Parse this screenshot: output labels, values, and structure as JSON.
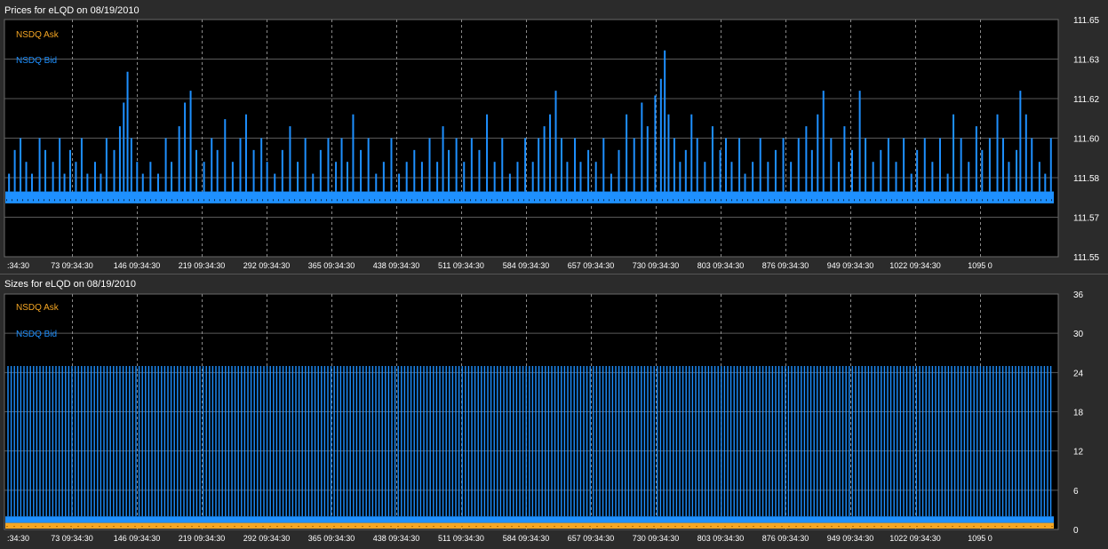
{
  "colors": {
    "panel_bg": "#2b2b2b",
    "plot_bg": "#000000",
    "grid": "#8a8a8a",
    "ask": "#f5a623",
    "bid": "#1e90ff",
    "text": "#ffffff"
  },
  "chart_data": [
    {
      "type": "line",
      "title": "Prices for  eLQD  on  08/19/2010",
      "legend": [
        {
          "name": "NSDQ Ask",
          "color": "#f5a623"
        },
        {
          "name": "NSDQ Bid",
          "color": "#1e90ff"
        }
      ],
      "legend_position": "top-left",
      "ylim": [
        111.55,
        111.65
      ],
      "y_ticks": [
        "111.65",
        "111.63",
        "111.62",
        "111.60",
        "111.58",
        "111.57",
        "111.55"
      ],
      "x_ticks": [
        ":34:30",
        "73 09:34:30",
        "146 09:34:30",
        "219 09:34:30",
        "292 09:34:30",
        "365 09:34:30",
        "438 09:34:30",
        "511 09:34:30",
        "584 09:34:30",
        "657 09:34:30",
        "730 09:34:30",
        "803 09:34:30",
        "876 09:34:30",
        "949 09:34:30",
        "1022 09:34:30",
        "1095 0"
      ],
      "x_range": [
        0,
        1095
      ],
      "grid": true,
      "series": [
        {
          "name": "NSDQ Bid",
          "base_band": [
            111.5725,
            111.5775
          ],
          "spikes": [
            [
              2,
              111.585
            ],
            [
              8,
              111.595
            ],
            [
              14,
              111.6
            ],
            [
              20,
              111.59
            ],
            [
              26,
              111.585
            ],
            [
              34,
              111.6
            ],
            [
              40,
              111.595
            ],
            [
              48,
              111.59
            ],
            [
              55,
              111.6
            ],
            [
              60,
              111.585
            ],
            [
              66,
              111.595
            ],
            [
              72,
              111.59
            ],
            [
              78,
              111.6
            ],
            [
              84,
              111.585
            ],
            [
              92,
              111.59
            ],
            [
              98,
              111.585
            ],
            [
              104,
              111.6
            ],
            [
              112,
              111.595
            ],
            [
              118,
              111.605
            ],
            [
              122,
              111.615
            ],
            [
              126,
              111.628
            ],
            [
              130,
              111.6
            ],
            [
              136,
              111.59
            ],
            [
              142,
              111.585
            ],
            [
              150,
              111.59
            ],
            [
              158,
              111.585
            ],
            [
              166,
              111.6
            ],
            [
              172,
              111.59
            ],
            [
              180,
              111.605
            ],
            [
              186,
              111.615
            ],
            [
              192,
              111.62
            ],
            [
              198,
              111.595
            ],
            [
              206,
              111.59
            ],
            [
              214,
              111.6
            ],
            [
              220,
              111.595
            ],
            [
              228,
              111.608
            ],
            [
              236,
              111.59
            ],
            [
              244,
              111.6
            ],
            [
              250,
              111.61
            ],
            [
              258,
              111.595
            ],
            [
              266,
              111.6
            ],
            [
              272,
              111.59
            ],
            [
              280,
              111.585
            ],
            [
              288,
              111.595
            ],
            [
              296,
              111.605
            ],
            [
              304,
              111.59
            ],
            [
              312,
              111.6
            ],
            [
              320,
              111.585
            ],
            [
              328,
              111.595
            ],
            [
              336,
              111.6
            ],
            [
              344,
              111.59
            ],
            [
              350,
              111.6
            ],
            [
              356,
              111.59
            ],
            [
              362,
              111.61
            ],
            [
              370,
              111.595
            ],
            [
              378,
              111.6
            ],
            [
              386,
              111.585
            ],
            [
              394,
              111.59
            ],
            [
              402,
              111.6
            ],
            [
              410,
              111.585
            ],
            [
              418,
              111.59
            ],
            [
              426,
              111.595
            ],
            [
              434,
              111.59
            ],
            [
              442,
              111.6
            ],
            [
              450,
              111.59
            ],
            [
              456,
              111.605
            ],
            [
              462,
              111.595
            ],
            [
              470,
              111.6
            ],
            [
              478,
              111.59
            ],
            [
              486,
              111.6
            ],
            [
              494,
              111.595
            ],
            [
              502,
              111.61
            ],
            [
              510,
              111.59
            ],
            [
              518,
              111.6
            ],
            [
              526,
              111.585
            ],
            [
              534,
              111.59
            ],
            [
              542,
              111.6
            ],
            [
              550,
              111.59
            ],
            [
              556,
              111.6
            ],
            [
              562,
              111.605
            ],
            [
              568,
              111.61
            ],
            [
              574,
              111.62
            ],
            [
              580,
              111.6
            ],
            [
              586,
              111.59
            ],
            [
              594,
              111.6
            ],
            [
              600,
              111.59
            ],
            [
              608,
              111.595
            ],
            [
              616,
              111.59
            ],
            [
              624,
              111.6
            ],
            [
              632,
              111.585
            ],
            [
              640,
              111.595
            ],
            [
              648,
              111.61
            ],
            [
              656,
              111.6
            ],
            [
              664,
              111.615
            ],
            [
              670,
              111.605
            ],
            [
              678,
              111.618
            ],
            [
              684,
              111.625
            ],
            [
              688,
              111.637
            ],
            [
              692,
              111.61
            ],
            [
              698,
              111.6
            ],
            [
              704,
              111.59
            ],
            [
              710,
              111.595
            ],
            [
              716,
              111.61
            ],
            [
              722,
              111.6
            ],
            [
              730,
              111.59
            ],
            [
              738,
              111.605
            ],
            [
              746,
              111.595
            ],
            [
              752,
              111.6
            ],
            [
              758,
              111.59
            ],
            [
              766,
              111.6
            ],
            [
              772,
              111.585
            ],
            [
              780,
              111.59
            ],
            [
              788,
              111.6
            ],
            [
              796,
              111.59
            ],
            [
              804,
              111.595
            ],
            [
              812,
              111.6
            ],
            [
              820,
              111.59
            ],
            [
              828,
              111.6
            ],
            [
              836,
              111.605
            ],
            [
              842,
              111.595
            ],
            [
              848,
              111.61
            ],
            [
              854,
              111.62
            ],
            [
              862,
              111.6
            ],
            [
              870,
              111.59
            ],
            [
              876,
              111.605
            ],
            [
              884,
              111.595
            ],
            [
              892,
              111.62
            ],
            [
              898,
              111.6
            ],
            [
              906,
              111.59
            ],
            [
              914,
              111.595
            ],
            [
              922,
              111.6
            ],
            [
              930,
              111.59
            ],
            [
              938,
              111.6
            ],
            [
              946,
              111.585
            ],
            [
              952,
              111.595
            ],
            [
              960,
              111.6
            ],
            [
              968,
              111.59
            ],
            [
              976,
              111.6
            ],
            [
              984,
              111.585
            ],
            [
              990,
              111.61
            ],
            [
              998,
              111.6
            ],
            [
              1006,
              111.59
            ],
            [
              1014,
              111.605
            ],
            [
              1020,
              111.595
            ],
            [
              1028,
              111.6
            ],
            [
              1036,
              111.61
            ],
            [
              1042,
              111.6
            ],
            [
              1048,
              111.59
            ],
            [
              1056,
              111.595
            ],
            [
              1060,
              111.62
            ],
            [
              1066,
              111.61
            ],
            [
              1072,
              111.6
            ],
            [
              1080,
              111.59
            ],
            [
              1086,
              111.585
            ],
            [
              1092,
              111.6
            ]
          ]
        },
        {
          "name": "NSDQ Ask",
          "values": []
        }
      ]
    },
    {
      "type": "bar",
      "title": "Sizes for  eLQD  on  08/19/2010",
      "legend": [
        {
          "name": "NSDQ Ask",
          "color": "#f5a623"
        },
        {
          "name": "NSDQ Bid",
          "color": "#1e90ff"
        }
      ],
      "legend_position": "top-left",
      "ylim": [
        0,
        36
      ],
      "y_ticks": [
        "36",
        "30",
        "24",
        "18",
        "12",
        "6",
        "0"
      ],
      "y_tick_values": [
        36,
        30,
        24,
        18,
        12,
        6,
        0
      ],
      "x_ticks": [
        ":34:30",
        "73 09:34:30",
        "146 09:34:30",
        "219 09:34:30",
        "292 09:34:30",
        "365 09:34:30",
        "438 09:34:30",
        "511 09:34:30",
        "584 09:34:30",
        "657 09:34:30",
        "730 09:34:30",
        "803 09:34:30",
        "876 09:34:30",
        "949 09:34:30",
        "1022 09:34:30",
        "1095 0"
      ],
      "x_range": [
        0,
        1095
      ],
      "grid": true,
      "series": [
        {
          "name": "NSDQ Bid",
          "bar_level": 25,
          "floor_level": 2
        },
        {
          "name": "NSDQ Ask",
          "floor_level": 1
        }
      ]
    }
  ]
}
